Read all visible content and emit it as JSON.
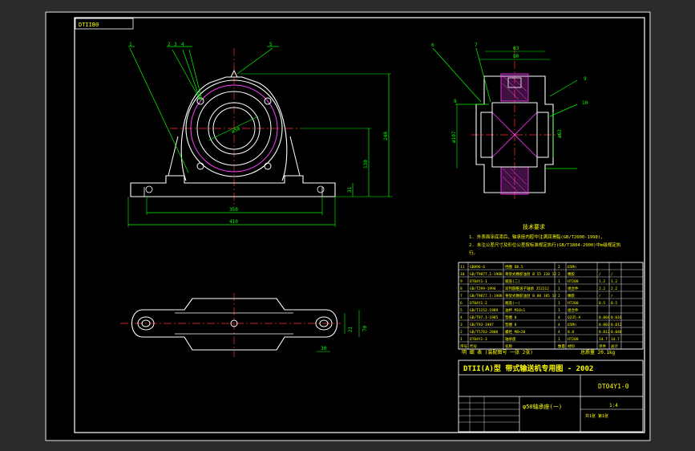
{
  "drawing_code": "DTIIB0",
  "leader_labels": {
    "front": [
      "1",
      "2",
      "3",
      "4",
      "5"
    ],
    "section": [
      "6",
      "7",
      "8",
      "9",
      "10"
    ]
  },
  "dimensions": {
    "front_bore": "ø58",
    "front_height_main": "240",
    "front_center_height": "130",
    "front_base_thk": "31",
    "front_bolt_span": "350",
    "front_total_len": "410",
    "section_top": "63",
    "section_top2": "80",
    "section_left_dia": "ø107",
    "section_right_dia": "ø62",
    "plan_dim1": "21",
    "plan_dim2": "70",
    "plan_dim3": "30"
  },
  "tech_requirements": {
    "title": "技术要求",
    "items": [
      "1. 外表面涂底漆后，轴承座内腔中注满润滑脂(GB/T2000-1998)，",
      "2. 未注公差尺寸及形位公差按标准规定执行(GB/T1804-2000)中m级规定执",
      "   行。"
    ]
  },
  "bom": {
    "rows": [
      {
        "no": "11",
        "code": "GB896-6",
        "name": "挡圈 D8.5",
        "qty": "2",
        "mat": "65Mn",
        "w1": "",
        "w2": ""
      },
      {
        "no": "10",
        "code": "GB/T9877.1-1988",
        "name": "骨架式橡胶油封 B 55 110 12",
        "qty": "2",
        "mat": "橡胶",
        "w1": "/",
        "w2": "/"
      },
      {
        "no": "9",
        "code": "DT04Y1-1",
        "name": "端盖(二)",
        "qty": "1",
        "mat": "HT200",
        "w1": "1.2",
        "w2": "1.2"
      },
      {
        "no": "8",
        "code": "GB/T299-1994",
        "name": "双列圆锥滚子轴承 352212",
        "qty": "1",
        "mat": "组合件",
        "w1": "2.2",
        "w2": "2.2"
      },
      {
        "no": "7",
        "code": "GB/T9877.1-1988",
        "name": "骨架式橡胶油封 B 80 105 12",
        "qty": "2",
        "mat": "橡胶",
        "w1": "/",
        "w2": "/"
      },
      {
        "no": "6",
        "code": "DT04Y1-2",
        "name": "端盖(一)",
        "qty": "1",
        "mat": "HT200",
        "w1": "0.5",
        "w2": "0.5"
      },
      {
        "no": "5",
        "code": "GB/T1152-1989",
        "name": "油杯 M10×1",
        "qty": "1",
        "mat": "组合件",
        "w1": "",
        "w2": ""
      },
      {
        "no": "4",
        "code": "GB/T97.1-1985",
        "name": "垫圈 8",
        "qty": "4",
        "mat": "Q235-A",
        "w1": "0.004",
        "w2": "0.016"
      },
      {
        "no": "3",
        "code": "GB/T93-1987",
        "name": "垫圈 8",
        "qty": "4",
        "mat": "65Mn",
        "w1": "0.003",
        "w2": "0.012"
      },
      {
        "no": "2",
        "code": "GB/T5783-2000",
        "name": "螺栓 M8×20",
        "qty": "4",
        "mat": "8.8",
        "w1": "0.012",
        "w2": "0.048"
      },
      {
        "no": "1",
        "code": "DT04Y1-3",
        "name": "轴承座",
        "qty": "1",
        "mat": "HT200",
        "w1": "14.7",
        "w2": "14.7"
      }
    ],
    "header": [
      "序号",
      "代号",
      "名称",
      "数量",
      "材料",
      "单件",
      "总计"
    ],
    "footer_label": "明 细 表  (装配图号 一张 2张)",
    "total_weight_label": "总质量  20.1kg"
  },
  "title_block": {
    "series_title": "DTII(A)型  带式输送机专用图 - 2002",
    "drawing_number": "DT04Y1-0",
    "part_name": "φ50轴承座(一)",
    "scale_label": "1:4",
    "sheet_label": "共1张 第1张"
  }
}
